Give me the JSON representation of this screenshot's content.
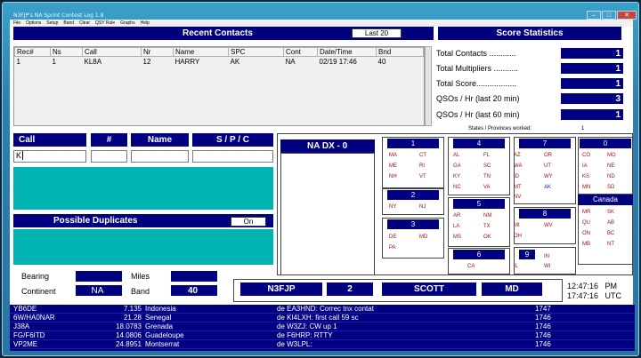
{
  "window": {
    "title": "N3FJP's NA Sprint Contest Log 1.8",
    "buttons": [
      "–",
      "□",
      "✕"
    ]
  },
  "menu": [
    "File",
    "Options",
    "Setup",
    "Band",
    "Clear",
    "QSY Rule",
    "Graphs",
    "Help"
  ],
  "recent_contacts": {
    "title": "Recent Contacts",
    "last_button": "Last 20",
    "columns": [
      "Rec#",
      "Ns",
      "Call",
      "Nr",
      "Name",
      "SPC",
      "Cont",
      "Date/Time",
      "Bnd"
    ],
    "rows": [
      [
        "1",
        "1",
        "KL8A",
        "12",
        "HARRY",
        "AK",
        "NA",
        "02/19 17:46",
        "40"
      ]
    ]
  },
  "score": {
    "title": "Score Statistics",
    "rows": [
      {
        "label": "Total Contacts ............",
        "value": "1"
      },
      {
        "label": "Total Multipliers ...........",
        "value": "1"
      },
      {
        "label": "Total Score..................",
        "value": "1"
      },
      {
        "label": "QSOs / Hr (last 20 min)",
        "value": "3"
      },
      {
        "label": "QSOs / Hr (last 60 min)",
        "value": "1"
      }
    ],
    "states_worked_label": "States / Provinces worked:",
    "states_worked_value": "1"
  },
  "entry": {
    "call_label": "Call",
    "num_label": "#",
    "name_label": "Name",
    "spc_label": "S / P / C",
    "call_value": "K",
    "num_value": "",
    "name_value": "",
    "spc_value": ""
  },
  "dupes": {
    "title": "Possible Duplicates",
    "toggle": "On"
  },
  "info": {
    "bearing_label": "Bearing",
    "miles_label": "Miles",
    "continent_label": "Continent",
    "continent_value": "NA",
    "band_label": "Band",
    "band_value": "40",
    "bearing_value": "",
    "miles_value": ""
  },
  "nadx": {
    "label": "NA DX -  0"
  },
  "districts": {
    "d1": {
      "num": "1",
      "states": [
        "MA",
        "CT",
        "ME",
        "RI",
        "NH",
        "VT"
      ]
    },
    "d2": {
      "num": "2",
      "states": [
        "NY",
        "NJ"
      ]
    },
    "d3": {
      "num": "3",
      "states": [
        "DE",
        "MD",
        "PA"
      ]
    },
    "d4": {
      "num": "4",
      "states": [
        "AL",
        "FL",
        "GA",
        "SC",
        "KY",
        "TN",
        "NC",
        "VA"
      ]
    },
    "d5": {
      "num": "5",
      "states": [
        "AR",
        "NM",
        "LA",
        "TX",
        "MS",
        "OK"
      ]
    },
    "d6": {
      "num": "6",
      "states": [
        "CA"
      ]
    },
    "d7": {
      "num": "7",
      "states": [
        "AZ",
        "OR",
        "WA",
        "UT",
        "ID",
        "WY",
        "MT",
        "AK",
        "NV"
      ]
    },
    "d8": {
      "num": "8",
      "states": [
        "MI",
        "WV",
        "OH"
      ]
    },
    "d9": {
      "num": "9",
      "states": [
        "IN",
        "IL",
        "WI"
      ]
    },
    "d0": {
      "num": "0",
      "states": [
        "CO",
        "MO",
        "IA",
        "NE",
        "KS",
        "ND",
        "MN",
        "SD"
      ]
    },
    "canada": {
      "title": "Canada",
      "provinces": [
        "MR",
        "SK",
        "QU",
        "AB",
        "ON",
        "BC",
        "MB",
        "NT"
      ]
    }
  },
  "station": {
    "call": "N3FJP",
    "num": "2",
    "name": "SCOTT",
    "spc": "MD",
    "local_time": "12:47:16   PM",
    "utc_time": "17:47:16   UTC"
  },
  "spots": [
    [
      "YB6DE",
      "7.135",
      "Indonesia",
      "de EA3HND:  Correc  tnx contat",
      "1747"
    ],
    [
      "6W/HA0NAR",
      "21.28",
      "Senegal",
      "de KI4LXH:  first call 59 sc",
      "1746"
    ],
    [
      "J38A",
      "18.0783",
      "Grenada",
      "de W3ZJ:  CW up 1",
      "1746"
    ],
    [
      "FG/F6ITD",
      "14.0806",
      "Guadeloupe",
      "de F6HRP:  RTTY",
      "1746"
    ],
    [
      "VP2ME",
      "24.8951",
      "Montserrat",
      "de W3LPL:",
      "1746"
    ]
  ],
  "colors": {
    "navy": "#000080",
    "cyan": "#00b3b3",
    "state_red": "#a01010",
    "state_blue": "#1515c0"
  }
}
